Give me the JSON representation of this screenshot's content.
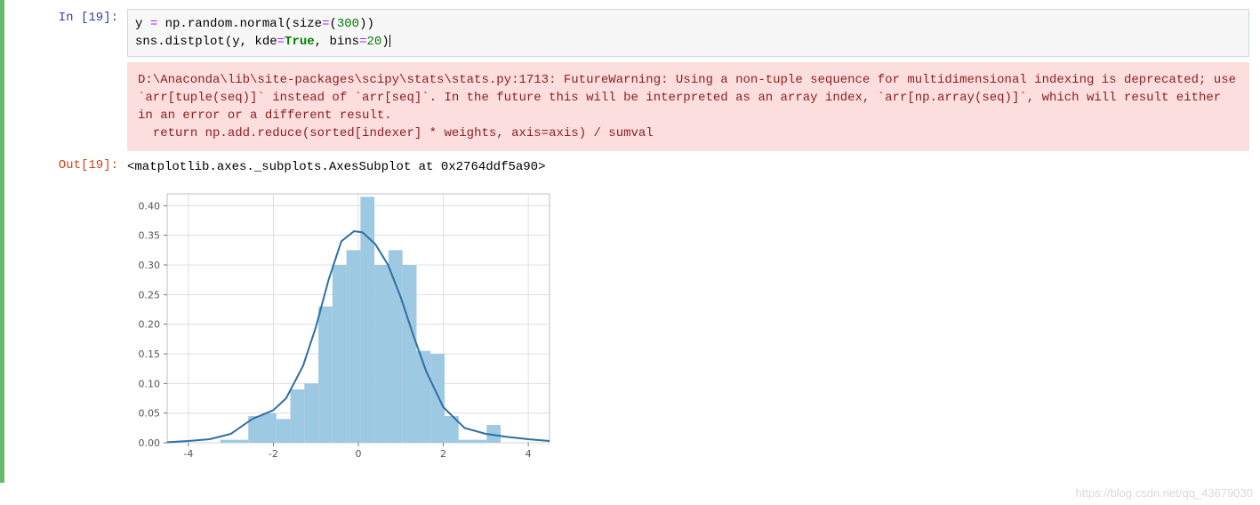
{
  "cell": {
    "in_prompt": "In  [19]:",
    "out_prompt": "Out[19]:",
    "code_tokens": [
      {
        "t": "y ",
        "c": "tok-var"
      },
      {
        "t": "=",
        "c": "tok-op"
      },
      {
        "t": " np.random.normal(size",
        "c": "tok-func"
      },
      {
        "t": "=",
        "c": "tok-op"
      },
      {
        "t": "(",
        "c": "tok-func"
      },
      {
        "t": "300",
        "c": "tok-num"
      },
      {
        "t": "))",
        "c": "tok-func"
      },
      {
        "t": "\n",
        "c": ""
      },
      {
        "t": "sns.distplot(y, kde",
        "c": "tok-func"
      },
      {
        "t": "=",
        "c": "tok-op"
      },
      {
        "t": "True",
        "c": "tok-bool"
      },
      {
        "t": ", bins",
        "c": "tok-func"
      },
      {
        "t": "=",
        "c": "tok-op"
      },
      {
        "t": "20",
        "c": "tok-num"
      },
      {
        "t": ")",
        "c": "tok-func"
      }
    ],
    "warning": "D:\\Anaconda\\lib\\site-packages\\scipy\\stats\\stats.py:1713: FutureWarning: Using a non-tuple sequence for multidimensional indexing is deprecated; use `arr[tuple(seq)]` instead of `arr[seq]`. In the future this will be interpreted as an array index, `arr[np.array(seq)]`, which will result either in an error or a different result.\n  return np.add.reduce(sorted[indexer] * weights, axis=axis) / sumval",
    "output_text": "<matplotlib.axes._subplots.AxesSubplot at 0x2764ddf5a90>"
  },
  "chart_data": {
    "type": "bar",
    "title": "",
    "xlabel": "",
    "ylabel": "",
    "xlim": [
      -4.5,
      4.5
    ],
    "ylim": [
      0,
      0.42
    ],
    "xticks": [
      -4,
      -2,
      0,
      2,
      4
    ],
    "yticks": [
      0.0,
      0.05,
      0.1,
      0.15,
      0.2,
      0.25,
      0.3,
      0.35,
      0.4
    ],
    "bin_edges": [
      -3.25,
      -2.92,
      -2.59,
      -2.26,
      -1.93,
      -1.6,
      -1.27,
      -0.94,
      -0.61,
      -0.28,
      0.05,
      0.38,
      0.71,
      1.04,
      1.37,
      1.7,
      2.03,
      2.36,
      2.69,
      3.02,
      3.35
    ],
    "bar_heights": [
      0.005,
      0.005,
      0.045,
      0.05,
      0.04,
      0.09,
      0.1,
      0.23,
      0.3,
      0.325,
      0.415,
      0.3,
      0.325,
      0.3,
      0.155,
      0.15,
      0.045,
      0.005,
      0.005,
      0.03
    ],
    "kde_points": [
      {
        "x": -4.5,
        "y": 0.001
      },
      {
        "x": -4.0,
        "y": 0.003
      },
      {
        "x": -3.5,
        "y": 0.006
      },
      {
        "x": -3.0,
        "y": 0.015
      },
      {
        "x": -2.5,
        "y": 0.04
      },
      {
        "x": -2.0,
        "y": 0.055
      },
      {
        "x": -1.7,
        "y": 0.075
      },
      {
        "x": -1.3,
        "y": 0.13
      },
      {
        "x": -1.0,
        "y": 0.195
      },
      {
        "x": -0.7,
        "y": 0.275
      },
      {
        "x": -0.4,
        "y": 0.34
      },
      {
        "x": -0.1,
        "y": 0.357
      },
      {
        "x": 0.1,
        "y": 0.355
      },
      {
        "x": 0.4,
        "y": 0.335
      },
      {
        "x": 0.7,
        "y": 0.3
      },
      {
        "x": 1.0,
        "y": 0.245
      },
      {
        "x": 1.3,
        "y": 0.18
      },
      {
        "x": 1.6,
        "y": 0.12
      },
      {
        "x": 2.0,
        "y": 0.06
      },
      {
        "x": 2.5,
        "y": 0.025
      },
      {
        "x": 3.0,
        "y": 0.015
      },
      {
        "x": 3.5,
        "y": 0.01
      },
      {
        "x": 4.0,
        "y": 0.006
      },
      {
        "x": 4.5,
        "y": 0.003
      }
    ]
  },
  "watermark": "https://blog.csdn.net/qq_43679030"
}
